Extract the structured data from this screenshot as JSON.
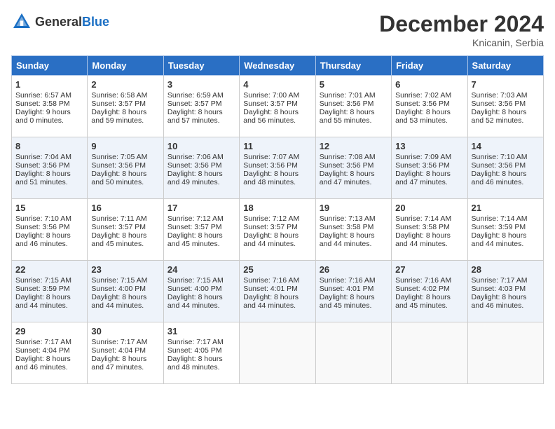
{
  "header": {
    "logo_general": "General",
    "logo_blue": "Blue",
    "month_title": "December 2024",
    "location": "Knicanin, Serbia"
  },
  "days_of_week": [
    "Sunday",
    "Monday",
    "Tuesday",
    "Wednesday",
    "Thursday",
    "Friday",
    "Saturday"
  ],
  "weeks": [
    [
      {
        "day": "1",
        "sunrise": "Sunrise: 6:57 AM",
        "sunset": "Sunset: 3:58 PM",
        "daylight": "Daylight: 9 hours and 0 minutes."
      },
      {
        "day": "2",
        "sunrise": "Sunrise: 6:58 AM",
        "sunset": "Sunset: 3:57 PM",
        "daylight": "Daylight: 8 hours and 59 minutes."
      },
      {
        "day": "3",
        "sunrise": "Sunrise: 6:59 AM",
        "sunset": "Sunset: 3:57 PM",
        "daylight": "Daylight: 8 hours and 57 minutes."
      },
      {
        "day": "4",
        "sunrise": "Sunrise: 7:00 AM",
        "sunset": "Sunset: 3:57 PM",
        "daylight": "Daylight: 8 hours and 56 minutes."
      },
      {
        "day": "5",
        "sunrise": "Sunrise: 7:01 AM",
        "sunset": "Sunset: 3:56 PM",
        "daylight": "Daylight: 8 hours and 55 minutes."
      },
      {
        "day": "6",
        "sunrise": "Sunrise: 7:02 AM",
        "sunset": "Sunset: 3:56 PM",
        "daylight": "Daylight: 8 hours and 53 minutes."
      },
      {
        "day": "7",
        "sunrise": "Sunrise: 7:03 AM",
        "sunset": "Sunset: 3:56 PM",
        "daylight": "Daylight: 8 hours and 52 minutes."
      }
    ],
    [
      {
        "day": "8",
        "sunrise": "Sunrise: 7:04 AM",
        "sunset": "Sunset: 3:56 PM",
        "daylight": "Daylight: 8 hours and 51 minutes."
      },
      {
        "day": "9",
        "sunrise": "Sunrise: 7:05 AM",
        "sunset": "Sunset: 3:56 PM",
        "daylight": "Daylight: 8 hours and 50 minutes."
      },
      {
        "day": "10",
        "sunrise": "Sunrise: 7:06 AM",
        "sunset": "Sunset: 3:56 PM",
        "daylight": "Daylight: 8 hours and 49 minutes."
      },
      {
        "day": "11",
        "sunrise": "Sunrise: 7:07 AM",
        "sunset": "Sunset: 3:56 PM",
        "daylight": "Daylight: 8 hours and 48 minutes."
      },
      {
        "day": "12",
        "sunrise": "Sunrise: 7:08 AM",
        "sunset": "Sunset: 3:56 PM",
        "daylight": "Daylight: 8 hours and 47 minutes."
      },
      {
        "day": "13",
        "sunrise": "Sunrise: 7:09 AM",
        "sunset": "Sunset: 3:56 PM",
        "daylight": "Daylight: 8 hours and 47 minutes."
      },
      {
        "day": "14",
        "sunrise": "Sunrise: 7:10 AM",
        "sunset": "Sunset: 3:56 PM",
        "daylight": "Daylight: 8 hours and 46 minutes."
      }
    ],
    [
      {
        "day": "15",
        "sunrise": "Sunrise: 7:10 AM",
        "sunset": "Sunset: 3:56 PM",
        "daylight": "Daylight: 8 hours and 46 minutes."
      },
      {
        "day": "16",
        "sunrise": "Sunrise: 7:11 AM",
        "sunset": "Sunset: 3:57 PM",
        "daylight": "Daylight: 8 hours and 45 minutes."
      },
      {
        "day": "17",
        "sunrise": "Sunrise: 7:12 AM",
        "sunset": "Sunset: 3:57 PM",
        "daylight": "Daylight: 8 hours and 45 minutes."
      },
      {
        "day": "18",
        "sunrise": "Sunrise: 7:12 AM",
        "sunset": "Sunset: 3:57 PM",
        "daylight": "Daylight: 8 hours and 44 minutes."
      },
      {
        "day": "19",
        "sunrise": "Sunrise: 7:13 AM",
        "sunset": "Sunset: 3:58 PM",
        "daylight": "Daylight: 8 hours and 44 minutes."
      },
      {
        "day": "20",
        "sunrise": "Sunrise: 7:14 AM",
        "sunset": "Sunset: 3:58 PM",
        "daylight": "Daylight: 8 hours and 44 minutes."
      },
      {
        "day": "21",
        "sunrise": "Sunrise: 7:14 AM",
        "sunset": "Sunset: 3:59 PM",
        "daylight": "Daylight: 8 hours and 44 minutes."
      }
    ],
    [
      {
        "day": "22",
        "sunrise": "Sunrise: 7:15 AM",
        "sunset": "Sunset: 3:59 PM",
        "daylight": "Daylight: 8 hours and 44 minutes."
      },
      {
        "day": "23",
        "sunrise": "Sunrise: 7:15 AM",
        "sunset": "Sunset: 4:00 PM",
        "daylight": "Daylight: 8 hours and 44 minutes."
      },
      {
        "day": "24",
        "sunrise": "Sunrise: 7:15 AM",
        "sunset": "Sunset: 4:00 PM",
        "daylight": "Daylight: 8 hours and 44 minutes."
      },
      {
        "day": "25",
        "sunrise": "Sunrise: 7:16 AM",
        "sunset": "Sunset: 4:01 PM",
        "daylight": "Daylight: 8 hours and 44 minutes."
      },
      {
        "day": "26",
        "sunrise": "Sunrise: 7:16 AM",
        "sunset": "Sunset: 4:01 PM",
        "daylight": "Daylight: 8 hours and 45 minutes."
      },
      {
        "day": "27",
        "sunrise": "Sunrise: 7:16 AM",
        "sunset": "Sunset: 4:02 PM",
        "daylight": "Daylight: 8 hours and 45 minutes."
      },
      {
        "day": "28",
        "sunrise": "Sunrise: 7:17 AM",
        "sunset": "Sunset: 4:03 PM",
        "daylight": "Daylight: 8 hours and 46 minutes."
      }
    ],
    [
      {
        "day": "29",
        "sunrise": "Sunrise: 7:17 AM",
        "sunset": "Sunset: 4:04 PM",
        "daylight": "Daylight: 8 hours and 46 minutes."
      },
      {
        "day": "30",
        "sunrise": "Sunrise: 7:17 AM",
        "sunset": "Sunset: 4:04 PM",
        "daylight": "Daylight: 8 hours and 47 minutes."
      },
      {
        "day": "31",
        "sunrise": "Sunrise: 7:17 AM",
        "sunset": "Sunset: 4:05 PM",
        "daylight": "Daylight: 8 hours and 48 minutes."
      },
      null,
      null,
      null,
      null
    ]
  ]
}
